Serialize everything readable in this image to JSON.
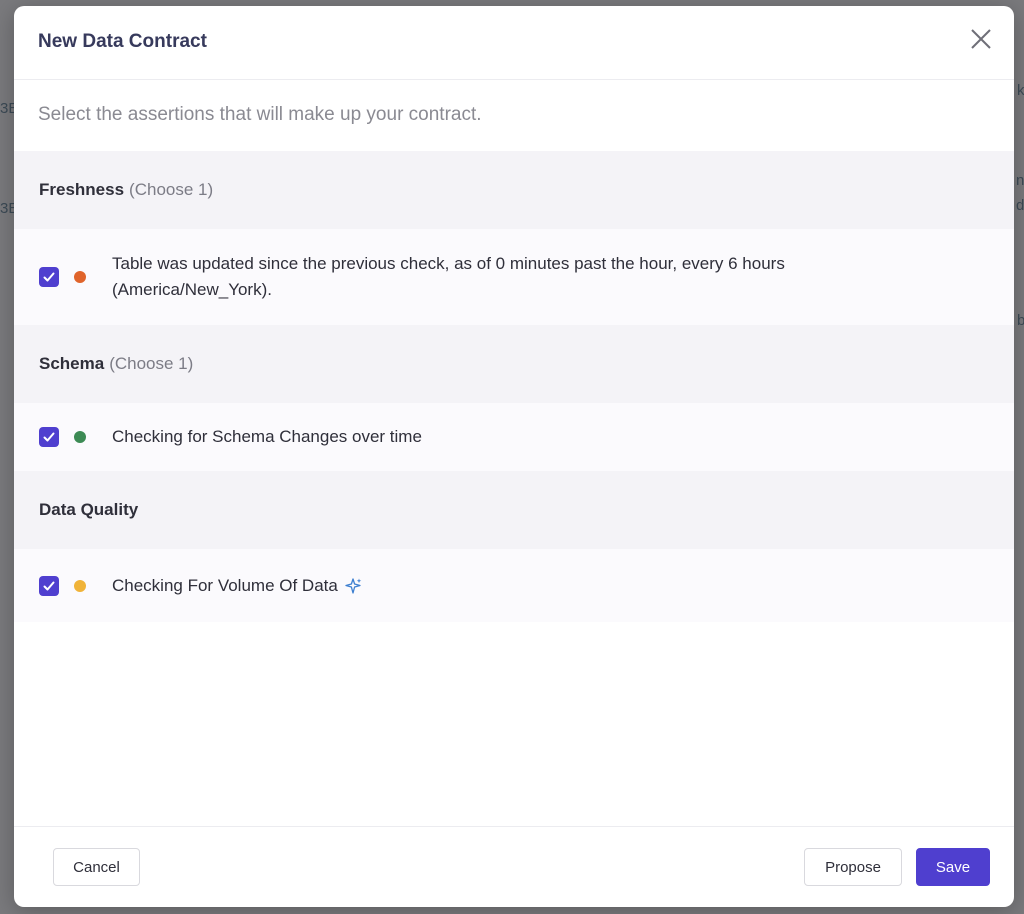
{
  "modal": {
    "title": "New Data Contract",
    "subtitle": "Select the assertions that will make up your contract."
  },
  "sections": [
    {
      "name": "Freshness",
      "hint": "(Choose 1)",
      "items": [
        {
          "text": "Table was updated since the previous check, as of 0 minutes past the hour, every 6 hours (America/New_York).",
          "checked": true,
          "status_color": "#e0642b"
        }
      ]
    },
    {
      "name": "Schema",
      "hint": "(Choose 1)",
      "items": [
        {
          "text": "Checking for Schema Changes over time",
          "checked": true,
          "status_color": "#3c8a54"
        }
      ]
    },
    {
      "name": "Data Quality",
      "hint": "",
      "items": [
        {
          "text": "Checking For Volume Of Data",
          "checked": true,
          "status_color": "#f0b339",
          "icon": "sparkle-icon"
        }
      ]
    }
  ],
  "footer": {
    "cancel_label": "Cancel",
    "propose_label": "Propose",
    "save_label": "Save"
  },
  "colors": {
    "accent": "#4f3fcf",
    "title": "#373a5c"
  }
}
